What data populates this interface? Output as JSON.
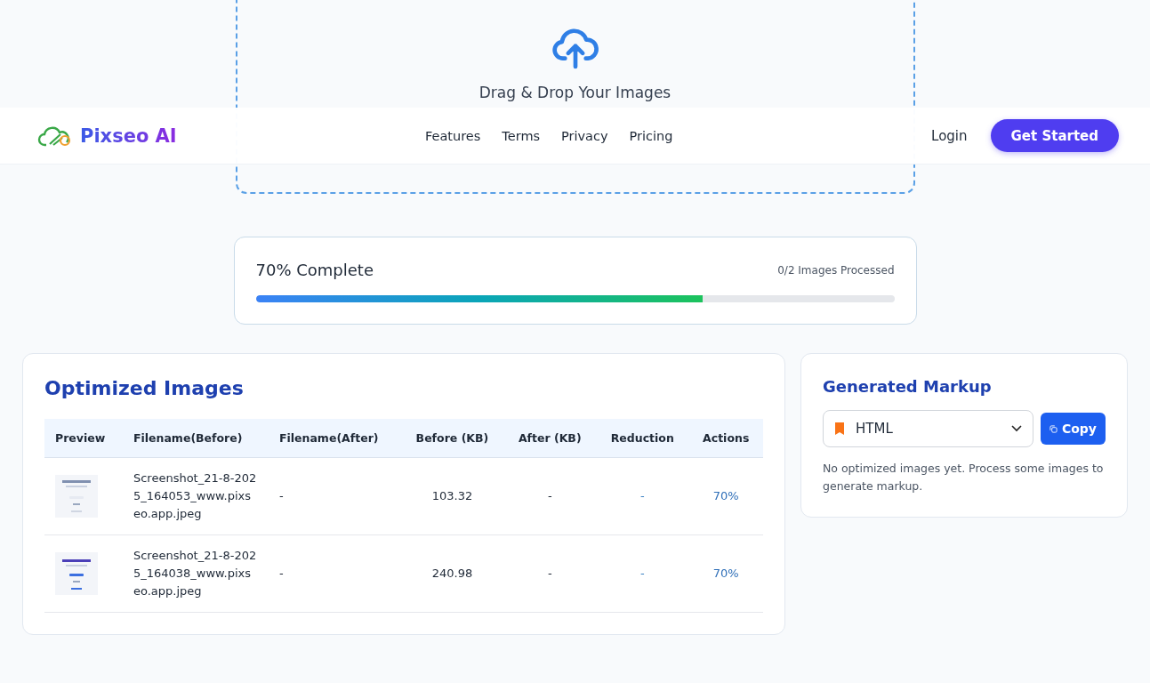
{
  "upload": {
    "title": "Drag & Drop Your Images"
  },
  "navbar": {
    "brand": "Pixseo AI",
    "links": [
      "Features",
      "Terms",
      "Privacy",
      "Pricing"
    ],
    "login": "Login",
    "cta": "Get Started"
  },
  "progress": {
    "label": "70% Complete",
    "count": "0/2 Images Processed",
    "level": 0.7
  },
  "optimized": {
    "title": "Optimized Images",
    "columns": [
      "Preview",
      "Filename(Before)",
      "Filename(After)",
      "Before (KB)",
      "After (KB)",
      "Reduction",
      "Actions"
    ],
    "rows": [
      {
        "before_name": "Screenshot_21-8-2025_164053_www.pixseo.app.jpeg",
        "after_name": "-",
        "before_kb": "103.32",
        "after_kb": "-",
        "reduction": "-",
        "action": "70%"
      },
      {
        "before_name": "Screenshot_21-8-2025_164038_www.pixseo.app.jpeg",
        "after_name": "-",
        "before_kb": "240.98",
        "after_kb": "-",
        "reduction": "-",
        "action": "70%"
      }
    ]
  },
  "markup": {
    "title": "Generated Markup",
    "format": "HTML",
    "copy": "Copy",
    "note": "No optimized images yet. Process some images to generate markup."
  }
}
